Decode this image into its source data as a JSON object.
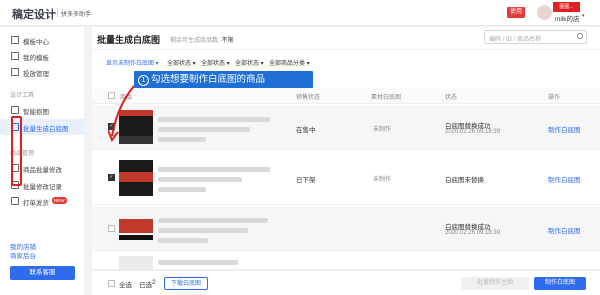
{
  "app": {
    "logo": "稿定设计",
    "sub": "拼多多助手",
    "top_button": "使用",
    "user_tag": "图图...",
    "user_name": "milk的店"
  },
  "sidebar": {
    "items": [
      {
        "label": "模板中心"
      },
      {
        "label": "我的模板"
      },
      {
        "label": "投放管理"
      }
    ],
    "design_section": "设计工具",
    "design_items": [
      {
        "label": "智能抠图"
      },
      {
        "label": "批量生成白底图"
      }
    ],
    "goods_section": "商品管理",
    "goods_items": [
      {
        "label": "商品批量修改"
      },
      {
        "label": "批量修改记录"
      },
      {
        "label": "打单发货",
        "badge": "NEW"
      }
    ],
    "store_links": [
      "我的店铺",
      "商家后台"
    ],
    "cta": "联系客服"
  },
  "main": {
    "title": "批量生成白底图",
    "sub_label": "剩余可生成商品数:",
    "sub_value": "不限",
    "search_placeholder": "编码 / ID / 商品名称",
    "filters": [
      "显示未制作白底图",
      "全部状态",
      "全部状态",
      "全部状态",
      "全部商品分类"
    ],
    "tooltip_num": "1",
    "tooltip_text": "勾选想要制作白底图的商品",
    "columns": [
      "商品",
      "销售状态",
      "素材白底图",
      "状态",
      "操作"
    ],
    "rows": [
      {
        "sale": "在售中",
        "material": "未制作",
        "status": "白底图替换成功",
        "time": "2020.02.26 09:18:39",
        "action": "制作白底图"
      },
      {
        "sale": "已下架",
        "material": "未制作",
        "status": "白底图未替换",
        "time": "",
        "action": "制作白底图"
      },
      {
        "sale": "",
        "material": "",
        "status": "白底图替换成功",
        "time": "2020.02.26 09:18:39",
        "action": "制作白底图"
      }
    ],
    "footer": {
      "select_all": "全选",
      "selected_label": "已选",
      "selected_count": "2",
      "download": "下载白底图",
      "bulk_left": "批量制作主图",
      "bulk": "制作白底图"
    }
  },
  "colors": {
    "accent": "#2f6bed",
    "highlight": "#e02020",
    "tooltip": "#1f6fd6"
  }
}
